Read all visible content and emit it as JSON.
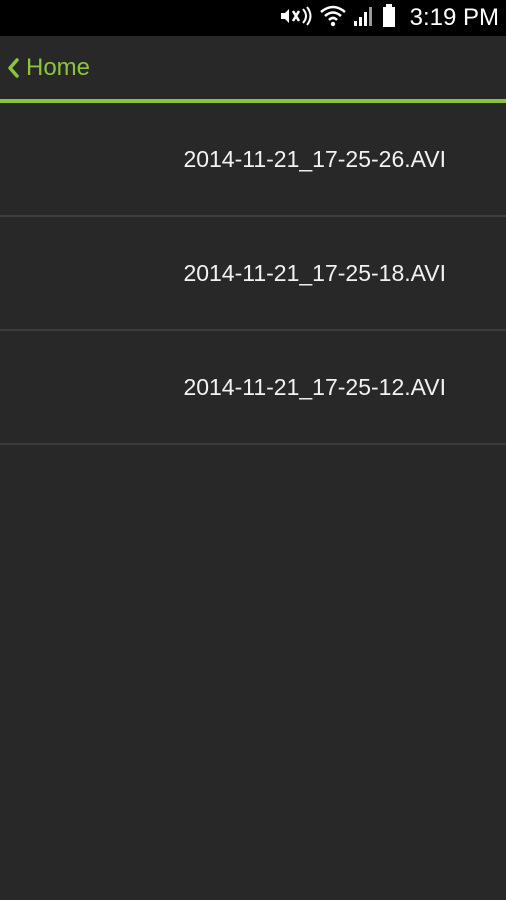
{
  "status_bar": {
    "time": "3:19 PM",
    "icons": [
      "mute-icon",
      "wifi-icon",
      "signal-icon",
      "battery-icon"
    ]
  },
  "action_bar": {
    "back_label": "Home",
    "back_icon": "chevron-left-icon",
    "accent_color": "#8cc43f"
  },
  "files": [
    {
      "name": "2014-11-21_17-25-26.AVI"
    },
    {
      "name": "2014-11-21_17-25-18.AVI"
    },
    {
      "name": "2014-11-21_17-25-12.AVI"
    }
  ]
}
